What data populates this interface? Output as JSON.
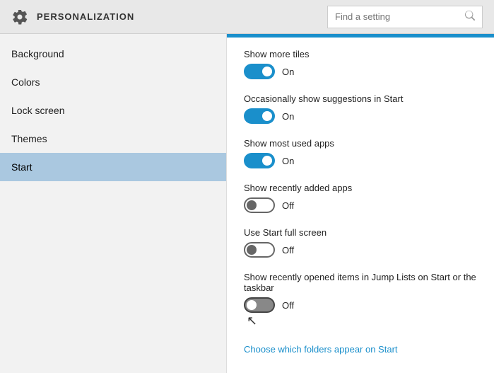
{
  "header": {
    "title": "PERSONALIZATION",
    "search_placeholder": "Find a setting"
  },
  "sidebar": {
    "items": [
      {
        "label": "Background",
        "active": false
      },
      {
        "label": "Colors",
        "active": false
      },
      {
        "label": "Lock screen",
        "active": false
      },
      {
        "label": "Themes",
        "active": false
      },
      {
        "label": "Start",
        "active": true
      }
    ]
  },
  "content": {
    "settings": [
      {
        "label": "Show more tiles",
        "state": "on",
        "status_text": "On"
      },
      {
        "label": "Occasionally show suggestions in Start",
        "state": "on",
        "status_text": "On"
      },
      {
        "label": "Show most used apps",
        "state": "on",
        "status_text": "On"
      },
      {
        "label": "Show recently added apps",
        "state": "off",
        "status_text": "Off"
      },
      {
        "label": "Use Start full screen",
        "state": "off",
        "status_text": "Off"
      },
      {
        "label": "Show recently opened items in Jump Lists on Start or the taskbar",
        "state": "off",
        "status_text": "Off"
      }
    ],
    "link_text": "Choose which folders appear on Start"
  },
  "icons": {
    "gear": "⚙",
    "search": "🔍"
  }
}
